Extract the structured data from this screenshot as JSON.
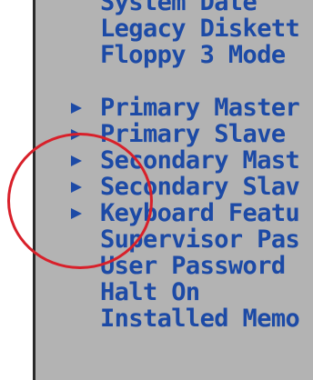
{
  "menu": {
    "items": [
      {
        "label": "System Date",
        "submenu": false
      },
      {
        "label": "Legacy Diskett",
        "submenu": false
      },
      {
        "label": "Floppy 3 Mode",
        "submenu": false
      },
      {
        "label": "",
        "submenu": false,
        "spacer": true
      },
      {
        "label": "Primary Master",
        "submenu": true
      },
      {
        "label": "Primary Slave",
        "submenu": true
      },
      {
        "label": "Secondary Mast",
        "submenu": true
      },
      {
        "label": "Secondary Slav",
        "submenu": true
      },
      {
        "label": "Keyboard Featu",
        "submenu": true
      },
      {
        "label": "Supervisor Pas",
        "submenu": false
      },
      {
        "label": "User Password",
        "submenu": false
      },
      {
        "label": "Halt On",
        "submenu": false
      },
      {
        "label": "Installed Memo",
        "submenu": false
      }
    ]
  },
  "colors": {
    "panel_background": "#b3b3b3",
    "text": "#1c4aa6",
    "annotation_circle": "#d8202a"
  },
  "icons": {
    "submenu_marker": "arrow-right-icon"
  }
}
